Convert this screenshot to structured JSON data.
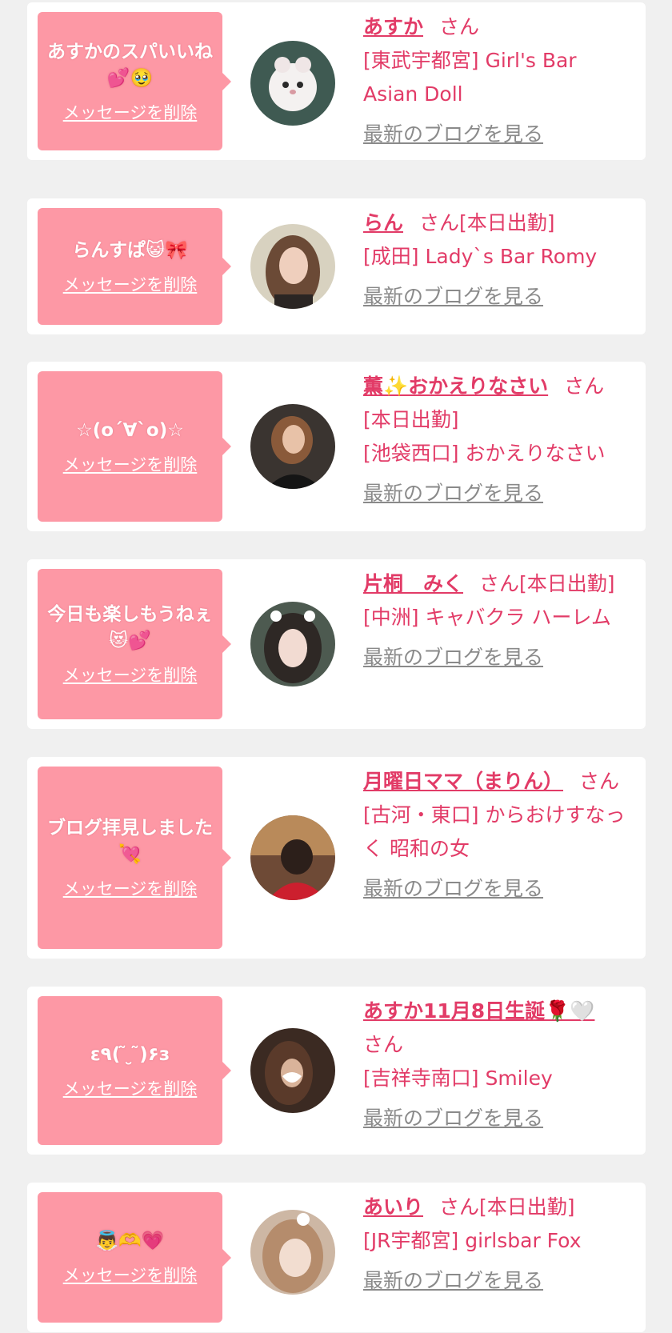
{
  "colors": {
    "background": "#f0f0f0",
    "card": "#ffffff",
    "bubble": "#fd98a5",
    "accent": "#e23b67",
    "link_gray": "#8a8a8a"
  },
  "labels": {
    "delete": "メッセージを削除",
    "blog": "最新のブログを見る"
  },
  "messages": [
    {
      "message": "あすかのスパいいね💕🥹",
      "name": "あすか",
      "suffix": "さん",
      "shop": "[東武宇都宮] Girl's Bar Asian Doll"
    },
    {
      "message": "らんすぱ😺🎀",
      "name": "らん",
      "suffix": "さん[本日出勤]",
      "shop": "[成田] Lady`s Bar Romy"
    },
    {
      "message": "☆(o´∀`o)☆",
      "name": "薫✨おかえりなさい",
      "suffix": "さん",
      "status": "[本日出勤]",
      "shop": "[池袋西口] おかえりなさい"
    },
    {
      "message": "今日も楽しもうねぇ😻💕",
      "name": "片桐　みく",
      "suffix": "さん[本日出勤]",
      "shop": "[中洲] キャバクラ ハーレム"
    },
    {
      "message": "ブログ拝見しました💘",
      "name": "月曜日ママ（まりん）",
      "suffix": "さん",
      "shop": "[古河・東口] からおけすなっく 昭和の女"
    },
    {
      "message": "ε٩( ̃ ̮ ̃)۶з",
      "name": "あすか11月8日生誕🌹🤍",
      "suffix": "さん",
      "shop": "[吉祥寺南口] Smiley"
    },
    {
      "message": "👼🫶💗",
      "name": "あいり",
      "suffix": "さん[本日出勤]",
      "shop": "[JR宇都宮] girlsbar Fox"
    }
  ]
}
